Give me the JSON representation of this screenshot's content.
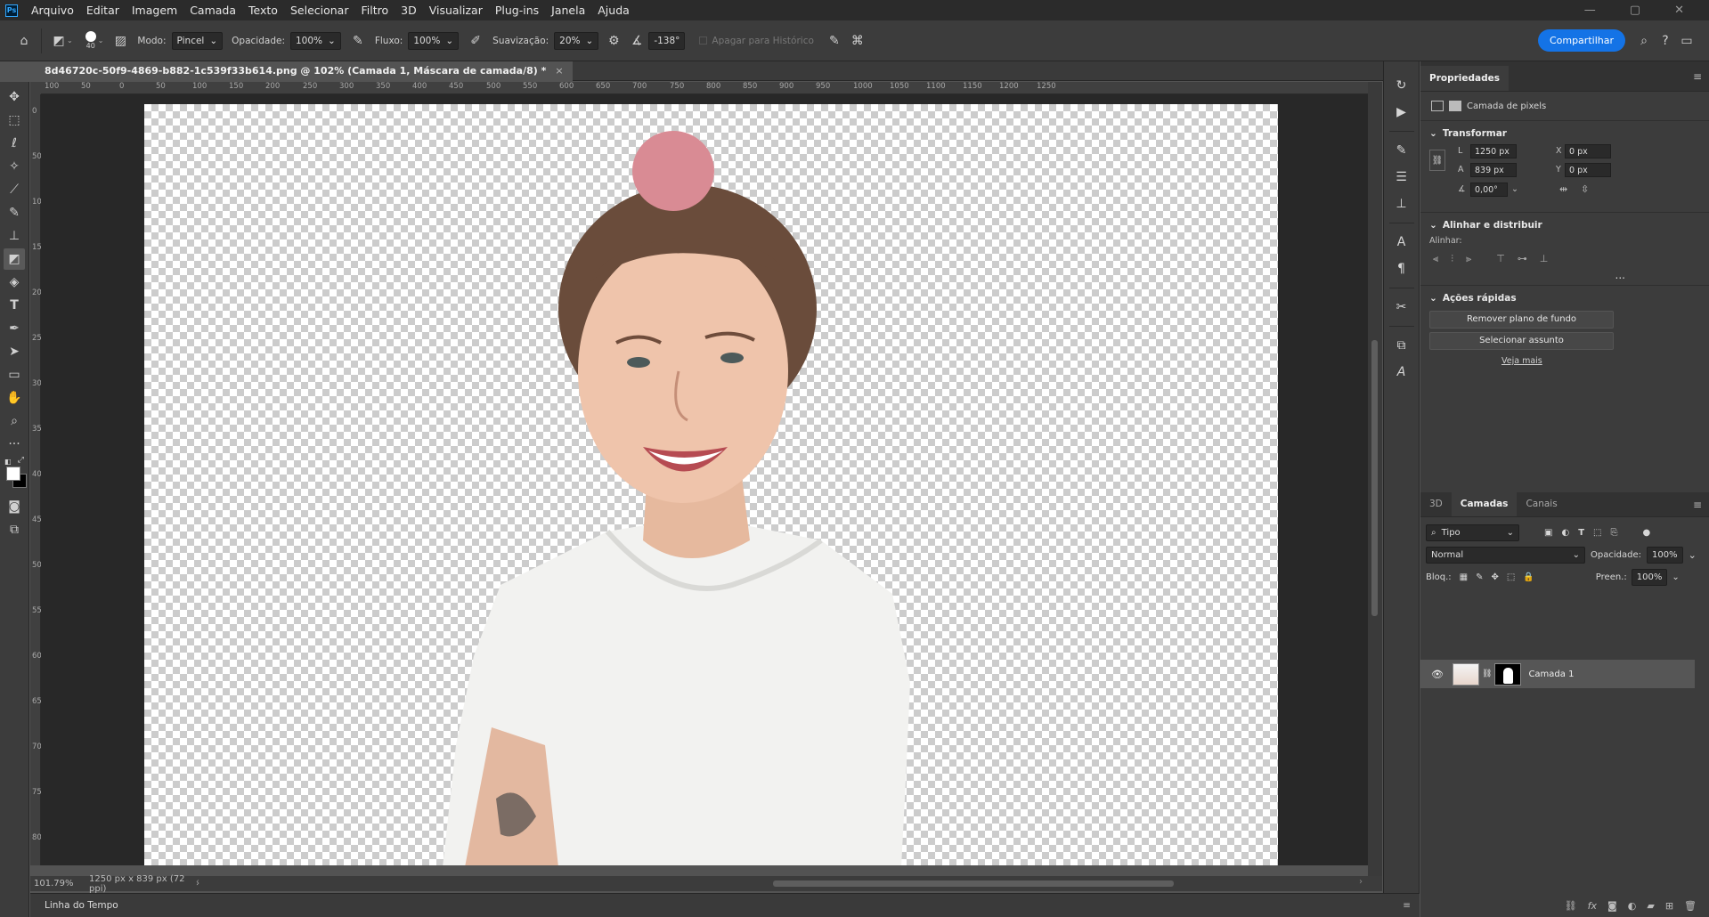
{
  "menu": [
    "Arquivo",
    "Editar",
    "Imagem",
    "Camada",
    "Texto",
    "Selecionar",
    "Filtro",
    "3D",
    "Visualizar",
    "Plug-ins",
    "Janela",
    "Ajuda"
  ],
  "app_logo": "Ps",
  "window_controls": [
    "—",
    "▢",
    "✕"
  ],
  "options": {
    "brush_size": "40",
    "mode_label": "Modo:",
    "mode_value": "Pincel",
    "opacity_label": "Opacidade:",
    "opacity_value": "100%",
    "flow_label": "Fluxo:",
    "flow_value": "100%",
    "smoothing_label": "Suavização:",
    "smoothing_value": "20%",
    "angle_value": "-138°",
    "erase_history_label": "Apagar para Histórico",
    "share_label": "Compartilhar"
  },
  "document": {
    "tab_title": "8d46720c-50f9-4869-b882-1c539f33b614.png @ 102% (Camada 1, Máscara de camada/8) *",
    "zoom": "101.79%",
    "doc_info": "1250 px x 839 px (72 ppi)"
  },
  "ruler_top": [
    "100",
    "50",
    "0",
    "50",
    "100",
    "150",
    "200",
    "250",
    "300",
    "350",
    "400",
    "450",
    "500",
    "550",
    "600",
    "650",
    "700",
    "750",
    "800",
    "850",
    "900",
    "950",
    "1000",
    "1050",
    "1100",
    "1150",
    "1200",
    "1250"
  ],
  "ruler_left": [
    "0",
    "50",
    "100",
    "150",
    "200",
    "250",
    "300",
    "350",
    "400",
    "450",
    "500",
    "550",
    "600",
    "650",
    "700",
    "750",
    "800"
  ],
  "timeline_label": "Linha do Tempo",
  "properties": {
    "tab_label": "Propriedades",
    "layer_type": "Camada de pixels",
    "transform_title": "Transformar",
    "w_label": "L",
    "w_value": "1250 px",
    "h_label": "A",
    "h_value": "839 px",
    "x_label": "X",
    "x_value": "0 px",
    "y_label": "Y",
    "y_value": "0 px",
    "angle_value": "0,00°",
    "align_title": "Alinhar e distribuir",
    "align_label": "Alinhar:",
    "more": "...",
    "quick_title": "Ações rápidas",
    "remove_bg": "Remover plano de fundo",
    "select_subject": "Selecionar assunto",
    "see_more": "Veja mais"
  },
  "layers": {
    "tabs": [
      "3D",
      "Camadas",
      "Canais"
    ],
    "filter_label": "Tipo",
    "blend_mode": "Normal",
    "opacity_label": "Opacidade:",
    "opacity_value": "100%",
    "lock_label": "Bloq.:",
    "fill_label": "Preen.:",
    "fill_value": "100%",
    "layer_name": "Camada 1"
  },
  "colors": {
    "accent": "#1473e6",
    "panel_bg": "#3c3c3c",
    "canvas_bg": "#282828"
  }
}
